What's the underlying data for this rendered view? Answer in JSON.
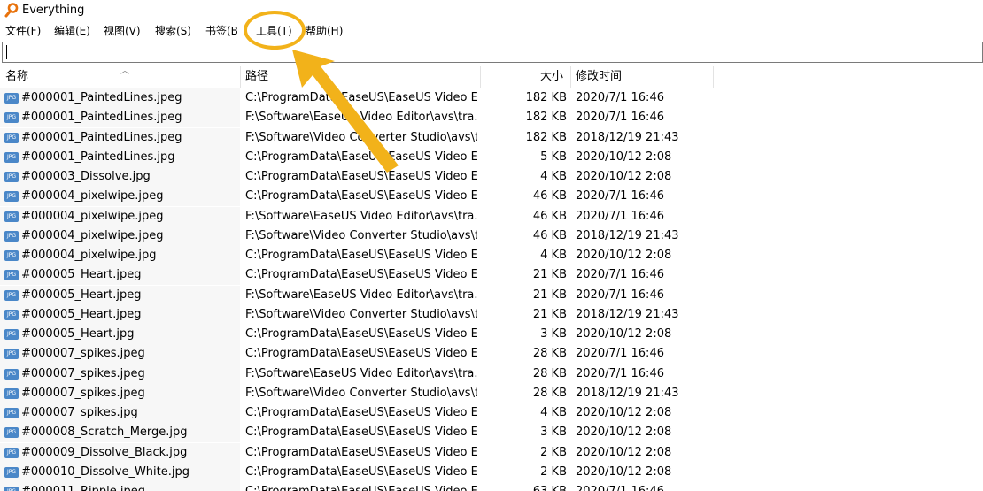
{
  "app": {
    "title": "Everything"
  },
  "menu": {
    "file": "文件(F)",
    "edit": "编辑(E)",
    "view": "视图(V)",
    "search": "搜索(S)",
    "bookmarks": "书签(B",
    "tools": "工具(T)",
    "help": "帮助(H)"
  },
  "search": {
    "value": ""
  },
  "columns": {
    "name": "名称",
    "path": "路径",
    "size": "大小",
    "modified": "修改时间"
  },
  "file_icon_label": "JPG",
  "rows": [
    {
      "name": "#000001_PaintedLines.jpeg",
      "path": "C:\\ProgramData\\EaseUS\\EaseUS Video E...",
      "size": "182 KB",
      "modified": "2020/7/1 16:46"
    },
    {
      "name": "#000001_PaintedLines.jpeg",
      "path": "F:\\Software\\EaseUS Video Editor\\avs\\tra...",
      "size": "182 KB",
      "modified": "2020/7/1 16:46"
    },
    {
      "name": "#000001_PaintedLines.jpeg",
      "path": "F:\\Software\\Video Converter Studio\\avs\\t...",
      "size": "182 KB",
      "modified": "2018/12/19 21:43"
    },
    {
      "name": "#000001_PaintedLines.jpg",
      "path": "C:\\ProgramData\\EaseUS\\EaseUS Video E...",
      "size": "5 KB",
      "modified": "2020/10/12 2:08"
    },
    {
      "name": "#000003_Dissolve.jpg",
      "path": "C:\\ProgramData\\EaseUS\\EaseUS Video E...",
      "size": "4 KB",
      "modified": "2020/10/12 2:08"
    },
    {
      "name": "#000004_pixelwipe.jpeg",
      "path": "C:\\ProgramData\\EaseUS\\EaseUS Video E...",
      "size": "46 KB",
      "modified": "2020/7/1 16:46"
    },
    {
      "name": "#000004_pixelwipe.jpeg",
      "path": "F:\\Software\\EaseUS Video Editor\\avs\\tra...",
      "size": "46 KB",
      "modified": "2020/7/1 16:46"
    },
    {
      "name": "#000004_pixelwipe.jpeg",
      "path": "F:\\Software\\Video Converter Studio\\avs\\t...",
      "size": "46 KB",
      "modified": "2018/12/19 21:43"
    },
    {
      "name": "#000004_pixelwipe.jpg",
      "path": "C:\\ProgramData\\EaseUS\\EaseUS Video E...",
      "size": "4 KB",
      "modified": "2020/10/12 2:08"
    },
    {
      "name": "#000005_Heart.jpeg",
      "path": "C:\\ProgramData\\EaseUS\\EaseUS Video E...",
      "size": "21 KB",
      "modified": "2020/7/1 16:46"
    },
    {
      "name": "#000005_Heart.jpeg",
      "path": "F:\\Software\\EaseUS Video Editor\\avs\\tra...",
      "size": "21 KB",
      "modified": "2020/7/1 16:46"
    },
    {
      "name": "#000005_Heart.jpeg",
      "path": "F:\\Software\\Video Converter Studio\\avs\\t...",
      "size": "21 KB",
      "modified": "2018/12/19 21:43"
    },
    {
      "name": "#000005_Heart.jpg",
      "path": "C:\\ProgramData\\EaseUS\\EaseUS Video E...",
      "size": "3 KB",
      "modified": "2020/10/12 2:08"
    },
    {
      "name": "#000007_spikes.jpeg",
      "path": "C:\\ProgramData\\EaseUS\\EaseUS Video E...",
      "size": "28 KB",
      "modified": "2020/7/1 16:46"
    },
    {
      "name": "#000007_spikes.jpeg",
      "path": "F:\\Software\\EaseUS Video Editor\\avs\\tra...",
      "size": "28 KB",
      "modified": "2020/7/1 16:46"
    },
    {
      "name": "#000007_spikes.jpeg",
      "path": "F:\\Software\\Video Converter Studio\\avs\\t...",
      "size": "28 KB",
      "modified": "2018/12/19 21:43"
    },
    {
      "name": "#000007_spikes.jpg",
      "path": "C:\\ProgramData\\EaseUS\\EaseUS Video E...",
      "size": "4 KB",
      "modified": "2020/10/12 2:08"
    },
    {
      "name": "#000008_Scratch_Merge.jpg",
      "path": "C:\\ProgramData\\EaseUS\\EaseUS Video E...",
      "size": "3 KB",
      "modified": "2020/10/12 2:08"
    },
    {
      "name": "#000009_Dissolve_Black.jpg",
      "path": "C:\\ProgramData\\EaseUS\\EaseUS Video E...",
      "size": "2 KB",
      "modified": "2020/10/12 2:08"
    },
    {
      "name": "#000010_Dissolve_White.jpg",
      "path": "C:\\ProgramData\\EaseUS\\EaseUS Video E...",
      "size": "2 KB",
      "modified": "2020/10/12 2:08"
    },
    {
      "name": "#000011_Ripple.jpeg",
      "path": "C:\\ProgramData\\EaseUS\\EaseUS Video E...",
      "size": "63 KB",
      "modified": "2020/7/1 16:46"
    }
  ],
  "colors": {
    "annotation": "#f2b21a",
    "file_icon": "#4a87c8",
    "name_column_bg": "#f7f7f7"
  }
}
